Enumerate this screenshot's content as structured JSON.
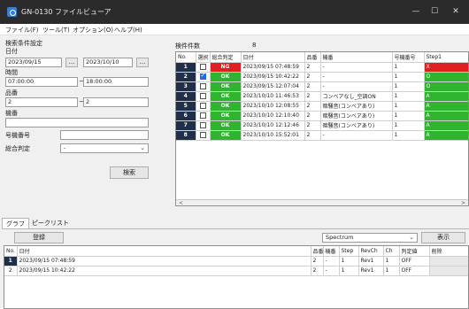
{
  "window": {
    "title": "GN-0130 ファイルビューア"
  },
  "title_buttons": {
    "minimize": "—",
    "maximize": "☐",
    "close": "✕"
  },
  "menu": [
    "ファイル(F)",
    "ツール(T)",
    "オプション(O)",
    "ヘルプ(H)"
  ],
  "search": {
    "section_title": "検索条件設定",
    "date_label": "日付",
    "date_from": "2023/09/15",
    "date_to": "2023/10/10",
    "picker_label": "...",
    "time_label": "時間",
    "time_from": "07:00:00",
    "time_to": "18:00:00",
    "product_label": "品番",
    "product_from": "2",
    "product_to": "2",
    "model_label": "機番",
    "model_value": "",
    "model_no_label": "号機番号",
    "model_no_value": "",
    "overall_label": "総合判定",
    "overall_value": "-",
    "range_sep": "~",
    "search_button": "検索"
  },
  "results": {
    "count_label": "検件件数",
    "count_value": "8",
    "columns": [
      "No.",
      "選択",
      "総合判定",
      "日付",
      "品番",
      "機番",
      "号機番号",
      "Step1"
    ],
    "rows": [
      {
        "no": "1",
        "checked": false,
        "judge": "NG",
        "date": "2023/09/15 07:48:59",
        "product": "2",
        "model": "-",
        "unit": "1",
        "step": "X"
      },
      {
        "no": "2",
        "checked": true,
        "judge": "OK",
        "date": "2023/09/15 10:42:22",
        "product": "2",
        "model": "-",
        "unit": "1",
        "step": "O"
      },
      {
        "no": "3",
        "checked": false,
        "judge": "OK",
        "date": "2023/09/15 12:07:04",
        "product": "2",
        "model": "-",
        "unit": "1",
        "step": "O"
      },
      {
        "no": "4",
        "checked": false,
        "judge": "OK",
        "date": "2023/10/10 11:46:53",
        "product": "2",
        "model": "コンベアなし_空調ON",
        "unit": "1",
        "step": "A"
      },
      {
        "no": "5",
        "checked": false,
        "judge": "OK",
        "date": "2023/10/10 12:08:55",
        "product": "2",
        "model": "暗騒音(コンベアあり)",
        "unit": "1",
        "step": "A"
      },
      {
        "no": "6",
        "checked": false,
        "judge": "OK",
        "date": "2023/10/10 12:10:40",
        "product": "2",
        "model": "暗騒音(コンベアあり)",
        "unit": "1",
        "step": "A"
      },
      {
        "no": "7",
        "checked": false,
        "judge": "OK",
        "date": "2023/10/10 12:12:46",
        "product": "2",
        "model": "暗騒音(コンベアあり)",
        "unit": "1",
        "step": "A"
      },
      {
        "no": "8",
        "checked": false,
        "judge": "OK",
        "date": "2023/10/10 15:52:01",
        "product": "2",
        "model": "-",
        "unit": "1",
        "step": "A"
      }
    ],
    "scroll_left": "<",
    "scroll_right": ">"
  },
  "tabs": [
    "グラフ",
    "ピークリスト"
  ],
  "graph": {
    "register_button": "登録",
    "spectrum_value": "Spectrum",
    "display_button": "表示",
    "columns": [
      "No.",
      "日付",
      "品番",
      "機番",
      "Step",
      "RevCh",
      "Ch",
      "判定値",
      "削除"
    ],
    "rows": [
      {
        "no": "1",
        "date": "2023/09/15 07:48:59",
        "product": "2",
        "model": "-",
        "step": "1",
        "rev": "Rev1",
        "ch": "1",
        "judge": "OFF"
      },
      {
        "no": "2",
        "date": "2023/09/15 10:42:22",
        "product": "2",
        "model": "-",
        "step": "1",
        "rev": "Rev1",
        "ch": "1",
        "judge": "OFF"
      }
    ]
  },
  "colors": {
    "ok": "#2fb42f",
    "ng": "#e02020",
    "step_x": "#e02020",
    "step_o": "#2fb42f",
    "step_a": "#2fb42f",
    "row_header": "#1f2f4a"
  }
}
